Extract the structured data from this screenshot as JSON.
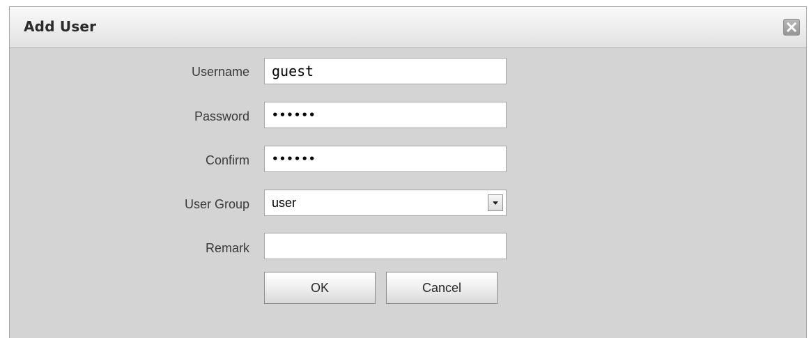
{
  "dialog": {
    "title": "Add User",
    "close_icon": "close-icon"
  },
  "form": {
    "username": {
      "label": "Username",
      "value": "guest"
    },
    "password": {
      "label": "Password",
      "value": "••••••"
    },
    "confirm": {
      "label": "Confirm",
      "value": "••••••"
    },
    "user_group": {
      "label": "User Group",
      "value": "user",
      "icon": "chevron-down-icon"
    },
    "remark": {
      "label": "Remark",
      "value": ""
    }
  },
  "buttons": {
    "ok_label": "OK",
    "cancel_label": "Cancel"
  }
}
